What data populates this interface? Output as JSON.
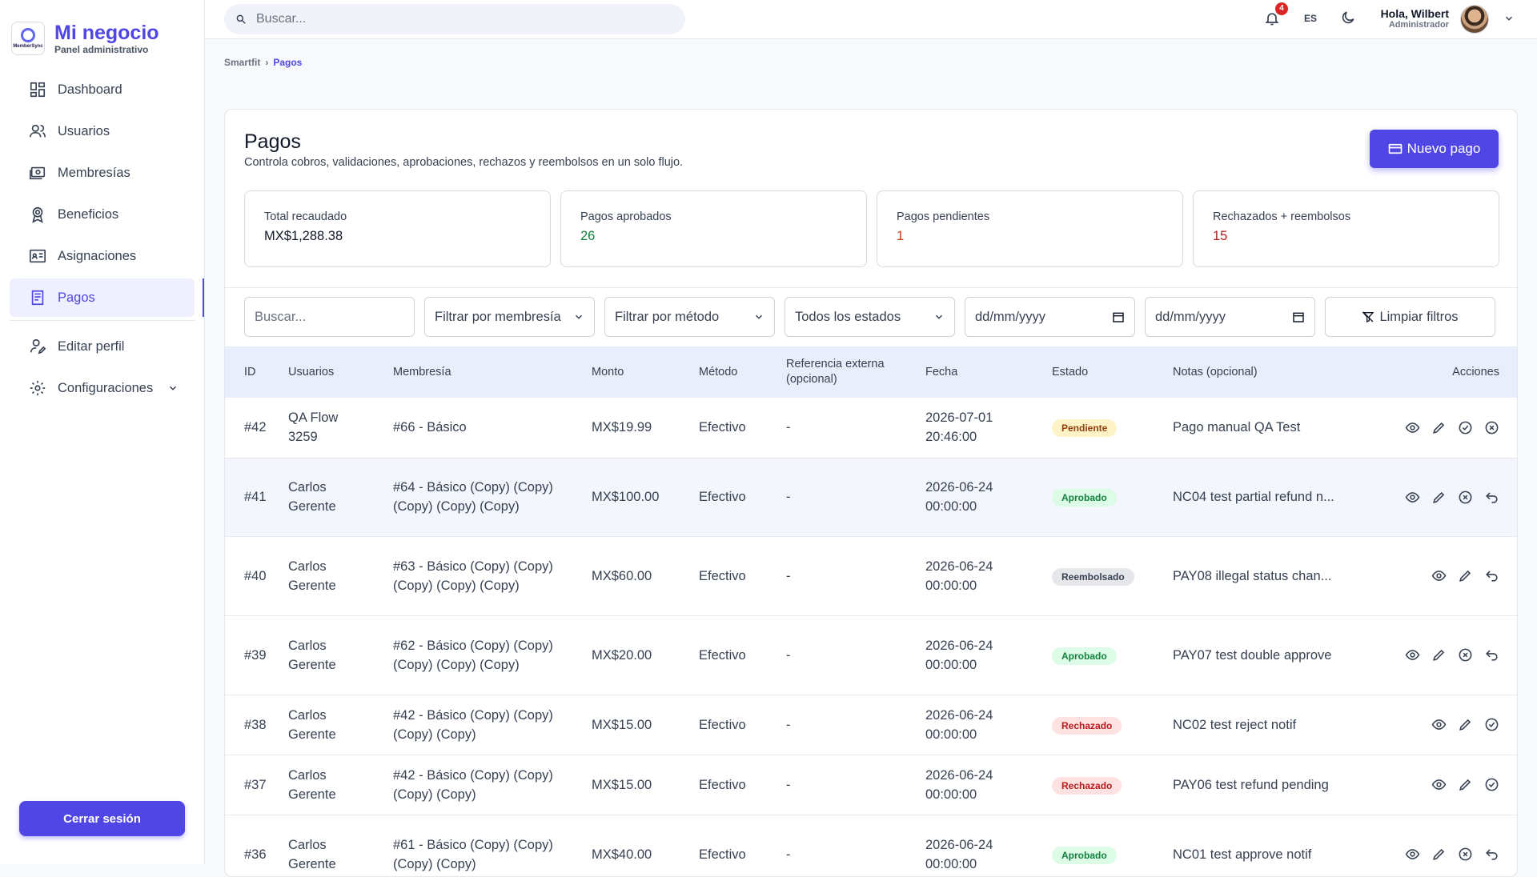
{
  "sidebar": {
    "brand_title": "Mi negocio",
    "brand_subtitle": "Panel administrativo",
    "logo_text": "MemberSync",
    "items": [
      {
        "label": "Dashboard",
        "icon": "dashboard-icon"
      },
      {
        "label": "Usuarios",
        "icon": "users-icon"
      },
      {
        "label": "Membresías",
        "icon": "membership-icon"
      },
      {
        "label": "Beneficios",
        "icon": "award-icon"
      },
      {
        "label": "Asignaciones",
        "icon": "id-card-icon"
      },
      {
        "label": "Pagos",
        "icon": "receipt-icon",
        "active": true
      },
      {
        "label": "Editar perfil",
        "icon": "user-edit-icon"
      },
      {
        "label": "Configuraciones",
        "icon": "gear-icon"
      }
    ],
    "logout_label": "Cerrar sesión"
  },
  "topbar": {
    "search_placeholder": "Buscar...",
    "notification_count": "4",
    "language": "ES",
    "greeting": "Hola, Wilbert",
    "role": "Administrador"
  },
  "breadcrumb": {
    "root": "Smartfit",
    "current": "Pagos"
  },
  "page": {
    "title": "Pagos",
    "description": "Controla cobros, validaciones, aprobaciones, rechazos y reembolsos en un solo flujo.",
    "new_button": "Nuevo pago"
  },
  "stats": [
    {
      "label": "Total recaudado",
      "value": "MX$1,288.38",
      "color": "#111827"
    },
    {
      "label": "Pagos aprobados",
      "value": "26",
      "color": "#15803d"
    },
    {
      "label": "Pagos pendientes",
      "value": "1",
      "color": "#c2410c"
    },
    {
      "label": "Rechazados + reembolsos",
      "value": "15",
      "color": "#b91c1c"
    }
  ],
  "filters": {
    "search_placeholder": "Buscar...",
    "membership": "Filtrar por membresía",
    "method": "Filtrar por método",
    "status": "Todos los estados",
    "date_from": "dd/mm/yyyy",
    "date_to": "dd/mm/yyyy",
    "clear": "Limpiar filtros"
  },
  "table": {
    "headers": [
      "ID",
      "Usuarios",
      "Membresía",
      "Monto",
      "Método",
      "Referencia externa (opcional)",
      "Fecha",
      "Estado",
      "Notas (opcional)",
      "Acciones"
    ],
    "rows": [
      {
        "id": "#42",
        "user": "QA Flow 3259",
        "membership": "#66 - Básico",
        "amount": "MX$19.99",
        "method": "Efectivo",
        "ref": "-",
        "date": "2026-07-01 20:46:00",
        "status": "Pendiente",
        "notes": "Pago manual QA Test",
        "actions": [
          "view",
          "edit",
          "approve",
          "reject"
        ]
      },
      {
        "id": "#41",
        "user": "Carlos Gerente",
        "membership": "#64 - Básico (Copy) (Copy) (Copy) (Copy) (Copy)",
        "amount": "MX$100.00",
        "method": "Efectivo",
        "ref": "-",
        "date": "2026-06-24 00:00:00",
        "status": "Aprobado",
        "notes": "NC04 test partial refund n...",
        "actions": [
          "view",
          "edit",
          "reject",
          "refund"
        ]
      },
      {
        "id": "#40",
        "user": "Carlos Gerente",
        "membership": "#63 - Básico (Copy) (Copy) (Copy) (Copy) (Copy)",
        "amount": "MX$60.00",
        "method": "Efectivo",
        "ref": "-",
        "date": "2026-06-24 00:00:00",
        "status": "Reembolsado",
        "notes": "PAY08 illegal status chan...",
        "actions": [
          "view",
          "edit",
          "refund"
        ]
      },
      {
        "id": "#39",
        "user": "Carlos Gerente",
        "membership": "#62 - Básico (Copy) (Copy) (Copy) (Copy) (Copy)",
        "amount": "MX$20.00",
        "method": "Efectivo",
        "ref": "-",
        "date": "2026-06-24 00:00:00",
        "status": "Aprobado",
        "notes": "PAY07 test double approve",
        "actions": [
          "view",
          "edit",
          "reject",
          "refund"
        ]
      },
      {
        "id": "#38",
        "user": "Carlos Gerente",
        "membership": "#42 - Básico (Copy) (Copy) (Copy) (Copy)",
        "amount": "MX$15.00",
        "method": "Efectivo",
        "ref": "-",
        "date": "2026-06-24 00:00:00",
        "status": "Rechazado",
        "notes": "NC02 test reject notif",
        "actions": [
          "view",
          "edit",
          "approve"
        ]
      },
      {
        "id": "#37",
        "user": "Carlos Gerente",
        "membership": "#42 - Básico (Copy) (Copy) (Copy) (Copy)",
        "amount": "MX$15.00",
        "method": "Efectivo",
        "ref": "-",
        "date": "2026-06-24 00:00:00",
        "status": "Rechazado",
        "notes": "PAY06 test refund pending",
        "actions": [
          "view",
          "edit",
          "approve"
        ]
      },
      {
        "id": "#36",
        "user": "Carlos Gerente",
        "membership": "#61 - Básico (Copy) (Copy) (Copy) (Copy)",
        "amount": "MX$40.00",
        "method": "Efectivo",
        "ref": "-",
        "date": "2026-06-24 00:00:00",
        "status": "Aprobado",
        "notes": "NC01 test approve notif",
        "actions": [
          "view",
          "edit",
          "reject",
          "refund"
        ]
      }
    ]
  },
  "status_colors": {
    "Pendiente": {
      "bg": "#fef3c7",
      "fg": "#92400e"
    },
    "Aprobado": {
      "bg": "#dcfce7",
      "fg": "#15803d"
    },
    "Reembolsado": {
      "bg": "#e5e7eb",
      "fg": "#374151"
    },
    "Rechazado": {
      "bg": "#fee2e2",
      "fg": "#b91c1c"
    }
  }
}
